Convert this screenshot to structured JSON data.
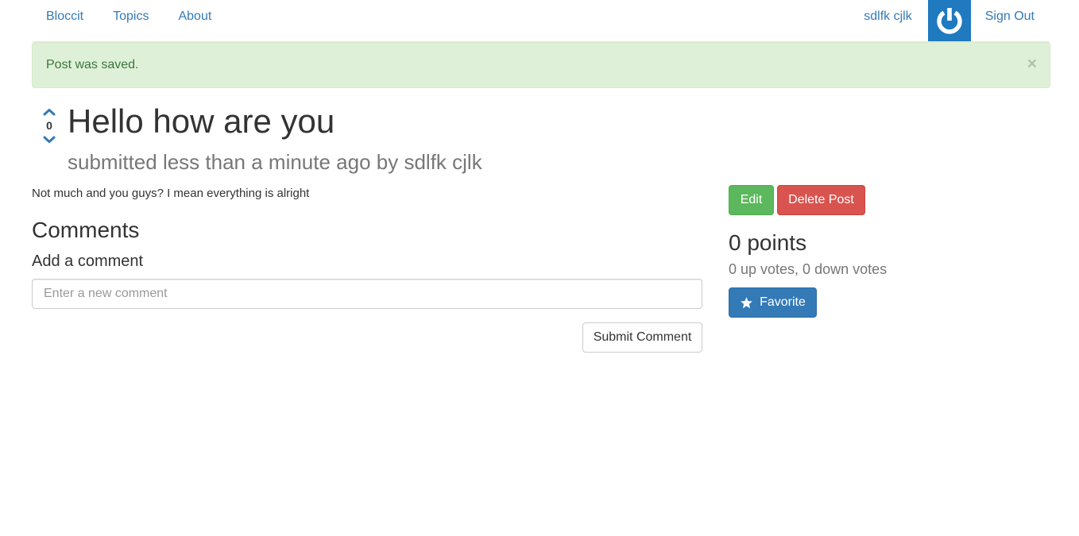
{
  "nav": {
    "brand": "Bloccit",
    "links": [
      "Topics",
      "About"
    ],
    "user_name": "sdlfk cjlk",
    "sign_out": "Sign Out"
  },
  "alert": {
    "message": "Post was saved.",
    "close_symbol": "×"
  },
  "post": {
    "vote_count": "0",
    "title": "Hello how are you",
    "meta": "submitted less than a minute ago by sdlfk cjlk",
    "body": "Not much and you guys? I mean everything is alright"
  },
  "comments": {
    "heading": "Comments",
    "add_label": "Add a comment",
    "input_value": "",
    "input_placeholder": "Enter a new comment",
    "submit_label": "Submit Comment"
  },
  "sidebar": {
    "edit_label": "Edit",
    "delete_label": "Delete Post",
    "points": "0 points",
    "votes_summary": "0 up votes, 0 down votes",
    "favorite_label": "Favorite"
  },
  "colors": {
    "link": "#337ab7",
    "avatar_bg": "#1f7ac0",
    "alert_bg": "#dff0d8",
    "alert_text": "#3c763d",
    "success": "#5cb85c",
    "danger": "#d9534f",
    "primary": "#337ab7"
  },
  "icons": {
    "avatar": "power-icon",
    "vote_up": "chevron-up-icon",
    "vote_down": "chevron-down-icon",
    "favorite": "star-icon"
  }
}
